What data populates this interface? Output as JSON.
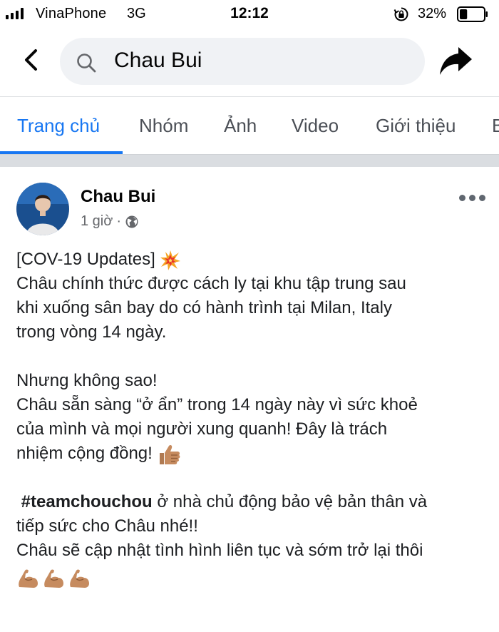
{
  "status_bar": {
    "carrier": "VinaPhone",
    "network": "3G",
    "time": "12:12",
    "battery": "32%",
    "battery_level": 0.32
  },
  "search": {
    "query": "Chau Bui"
  },
  "tabs": [
    {
      "label": "Trang chủ",
      "active": true
    },
    {
      "label": "Nhóm",
      "active": false
    },
    {
      "label": "Ảnh",
      "active": false
    },
    {
      "label": "Video",
      "active": false
    },
    {
      "label": "Giới thiệu",
      "active": false
    },
    {
      "label": "B",
      "active": false
    }
  ],
  "post": {
    "author": "Chau Bui",
    "time": "1 giờ",
    "separator": "·",
    "privacy_icon": "globe-icon",
    "headline": "[COV-19 Updates]",
    "headline_emoji": "collision-emoji",
    "para1": [
      "Châu chính thức được cách ly tại khu tập trung sau",
      "khi xuống sân bay do có hành trình tại Milan, Italy",
      "trong vòng 14 ngày."
    ],
    "para2": [
      "Nhưng không sao!",
      "Châu sẵn sàng “ở ẩn” trong 14 ngày này vì sức khoẻ",
      "của mình và mọi người xung quanh! Đây là trách",
      "nhiệm cộng đồng!"
    ],
    "para2_emoji": "thumbs-up-emoji",
    "hashtag": "#teamchouchou",
    "para3_first": " ở nhà chủ động bảo vệ bản thân và",
    "para3": [
      "tiếp sức cho Châu nhé!!",
      "Châu sẽ cập nhật tình hình liên tục và sớm trở lại thôi"
    ],
    "closing_emoji": "flexed-biceps-emoji"
  }
}
